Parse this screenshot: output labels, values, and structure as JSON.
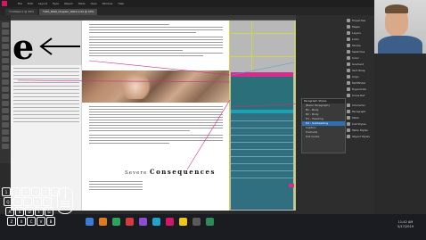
{
  "menubar": {
    "items": [
      "File",
      "Edit",
      "Layout",
      "Type",
      "Object",
      "Table",
      "View",
      "Window",
      "Help"
    ]
  },
  "tabs": [
    {
      "label": "*Untitled-1 @ 33%",
      "active": false
    },
    {
      "label": "*LEO_MAN_Chapter_0001.indd @ 93%",
      "active": true
    }
  ],
  "document": {
    "headline_small": "Severe",
    "headline_big": "Consequences"
  },
  "table": {
    "header": "Object Style"
  },
  "panels": {
    "properties_items": [
      "Properties",
      "Pages",
      "Layers",
      "Links",
      "Stroke",
      "Swatches",
      "Color",
      "Gradient",
      "Text Wrap",
      "Align",
      "Pathfinder",
      "Hyperlinks",
      "Cross-Ref",
      "Character",
      "Paragraph",
      "Table",
      "Cell Styles",
      "Table Styles",
      "Object Styles"
    ],
    "paragraph_styles": {
      "title": "Paragraph Styles",
      "rows": [
        {
          "label": "[Basic Paragraph]",
          "selected": false
        },
        {
          "label": "B1 - Body",
          "selected": false
        },
        {
          "label": "B2 - Body",
          "selected": false
        },
        {
          "label": "H1 - Heading",
          "selected": false
        },
        {
          "label": "H2 - Subheading",
          "selected": true
        },
        {
          "label": "Caption",
          "selected": false
        },
        {
          "label": "Footnote",
          "selected": false
        },
        {
          "label": "Pull Quote",
          "selected": false
        }
      ]
    }
  },
  "keyboard": {
    "keys": [
      "1",
      "2",
      "3",
      "4",
      "5",
      "6",
      "Q",
      "W",
      "E",
      "R",
      "T",
      "A",
      "S",
      "D",
      "F",
      "G",
      "Z",
      "X",
      "C",
      "V",
      "B"
    ]
  },
  "taskbar": {
    "time": "11:42 AM",
    "date": "5/17/2019",
    "colors": [
      "#3a7bd5",
      "#e07a1f",
      "#2aa55a",
      "#d43b3b",
      "#8a4fd0",
      "#1fa3c9",
      "#d4166b",
      "#f0c419",
      "#5a5a5a",
      "#2e8b57"
    ]
  },
  "colors": {
    "magenta": "#d12e8e",
    "teal": "#2b6f78",
    "guide_yellow": "#d2d645",
    "indesign": "#d4166b"
  }
}
